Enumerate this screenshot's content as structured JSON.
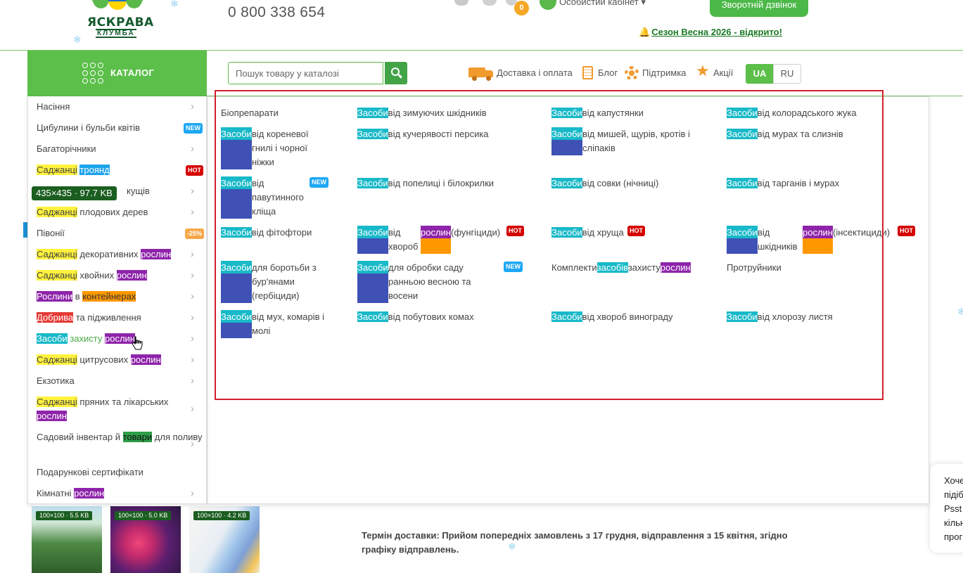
{
  "header": {
    "logo": {
      "name": "ЯСКРАВА",
      "sub": "КЛУМБА"
    },
    "phone": "0 800 338 654",
    "cart_count": "0",
    "cabinet_label": "Особистий кабінет ▾",
    "callback_label": "Зворотній дзвінок",
    "season_link": "Сезон Весна 2026 - відкрито!"
  },
  "nav": {
    "catalog_label": "КАТАЛОГ",
    "search_placeholder": "Пошук товару у каталозі",
    "links": {
      "delivery": "Доставка і оплата",
      "blog": "Блог",
      "support": "Підтримка",
      "promo": "Акції"
    },
    "lang": {
      "ua": "UA",
      "ru": "RU"
    }
  },
  "size_tooltip": "435×435 · 97.7 KB",
  "sidebar": {
    "items": [
      {
        "label": "Насіння"
      },
      {
        "label": "Цибулини і бульби квітів",
        "tag": "NEW"
      },
      {
        "label": "Багаторічники"
      },
      {
        "w1": "Саджанці",
        "w2": "троянд",
        "tag": "HOT"
      },
      {
        "label": "кущів"
      },
      {
        "w1": "Саджанці",
        "w2": "плодових дерев"
      },
      {
        "label": "Півонії",
        "tag": "-25%"
      },
      {
        "w1": "Саджанці",
        "w2": "декоративних",
        "w3": "рослин"
      },
      {
        "w1": "Саджанці",
        "w2": "хвойних",
        "w3": "рослин"
      },
      {
        "w1": "Рослини",
        "w2": "в",
        "w3": "контейнерах"
      },
      {
        "w1": "Добрива",
        "w2": "та підживлення"
      },
      {
        "w1": "Засоби",
        "w2": "захисту",
        "w3": "рослин"
      },
      {
        "w1": "Саджанці",
        "w2": "цитрусових",
        "w3": "рослин"
      },
      {
        "label": "Екзотика"
      },
      {
        "w1": "Саджанці",
        "w2": "пряних та лікарських",
        "w3": "рослин"
      },
      {
        "w1": "Садовий інвентар й",
        "w2": "товари",
        "w3": "для поливу"
      },
      {
        "label": "Подарункові сертифікати"
      },
      {
        "w1": "Кімнатні",
        "w2": "рослин"
      }
    ]
  },
  "submenu": {
    "hl": "Засоби",
    "hl_lower": "засобів",
    "plants": "рослин",
    "new": "NEW",
    "hot": "HOT",
    "items": {
      "bio": "Біопрепарати",
      "winter_pests": "від зимуючих шкідників",
      "cabbage": "від капустянки",
      "colorado": "від колорадського жука",
      "root_rot": "від кореневої гнилі і чорної ніжки",
      "curly_peach": "від кучерявості персика",
      "mice": "від мишей, щурів, кротів і сліпаків",
      "ants_slugs": "від мурах та слизнів",
      "spider_mite": "від павутинного кліща",
      "aphids": "від попелиці і білокрилки",
      "cutworms": "від совки (нічниці)",
      "cockroaches": "від тарганів і мурах",
      "phytophthora": "від фітофтори",
      "diseases_pre": "від хвороб",
      "fungicides": "(фунгіциди)",
      "grub": "від хруща",
      "pests_pre": "від шкідників",
      "insecticides": "(інсектициди)",
      "weeds": "для боротьби з бур'янами (гербіциди)",
      "spring": "для обробки саду ранньою весною та восени",
      "sets_pre": "Комплекти",
      "sets_mid": "захисту",
      "disinfect": "Протруйники",
      "flies": "від мух, комарів і молі",
      "household": "від побутових комах",
      "grape": "від хвороб винограду",
      "chlorosis": "від хлорозу листя"
    }
  },
  "thumbs": [
    "100×100 · 5.5 KB",
    "100×100 · 5.0 KB",
    "100×100 · 4.2 KB"
  ],
  "delivery_note": "Термін доставки: Прийом попередніх замовлень з 17 грудня, відправлення з 15 квітня, згідно графіку відправлень.",
  "chat": [
    "Хоче",
    "підіб",
    "Psst",
    "кільн",
    "прог"
  ]
}
